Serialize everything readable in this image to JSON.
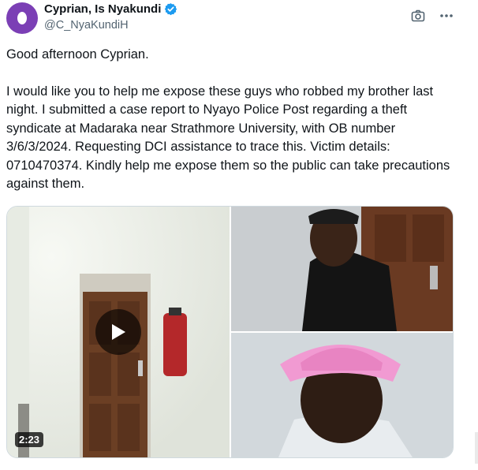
{
  "author": {
    "display_name": "Cyprian, Is Nyakundi",
    "handle": "@C_NyaKundiH",
    "avatar_color": "#7b3fb5",
    "verified": true,
    "verified_color": "#1d9bf0"
  },
  "toolbar": {
    "icons": [
      "camera-icon",
      "more-icon"
    ]
  },
  "tweet": {
    "paragraphs": [
      "Good afternoon Cyprian.",
      "I would like you to help me expose these guys who robbed my brother last night. I submitted a case report to Nyayo Police Post regarding a theft syndicate at Madaraka near Strathmore University, with OB number 3/6/3/2024. Requesting DCI assistance to trace this. Victim details: 0710470374. Kindly help me expose them so the public can take precautions against them."
    ]
  },
  "media": {
    "video_duration": "2:23",
    "tiles": [
      "cctv-hallway-door-video",
      "cctv-man-black-cap-photo",
      "cctv-man-pink-hat-photo"
    ]
  }
}
